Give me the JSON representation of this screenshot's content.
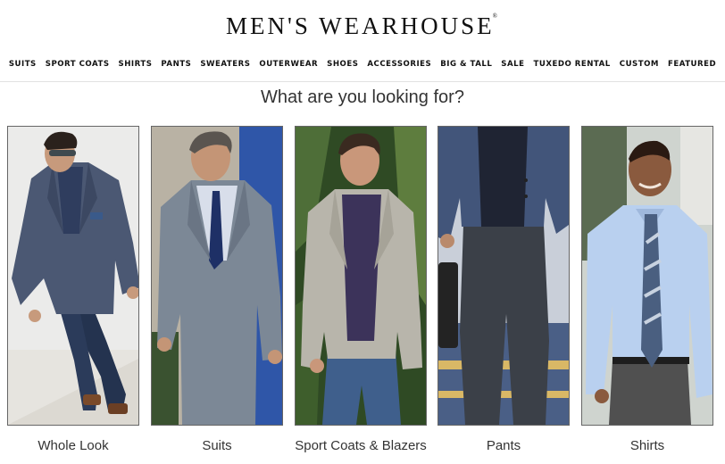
{
  "brand": {
    "name": "MEN'S WEARHOUSE",
    "mark": "®"
  },
  "nav": [
    {
      "label": "SUITS"
    },
    {
      "label": "SPORT COATS"
    },
    {
      "label": "SHIRTS"
    },
    {
      "label": "PANTS"
    },
    {
      "label": "SWEATERS"
    },
    {
      "label": "OUTERWEAR"
    },
    {
      "label": "SHOES"
    },
    {
      "label": "ACCESSORIES"
    },
    {
      "label": "BIG & TALL"
    },
    {
      "label": "SALE"
    },
    {
      "label": "TUXEDO RENTAL"
    },
    {
      "label": "CUSTOM"
    },
    {
      "label": "FEATURED"
    }
  ],
  "heading": "What are you looking for?",
  "categories": [
    {
      "label": "Whole Look"
    },
    {
      "label": "Suits"
    },
    {
      "label": "Sport Coats & Blazers"
    },
    {
      "label": "Pants"
    },
    {
      "label": "Shirts"
    }
  ]
}
